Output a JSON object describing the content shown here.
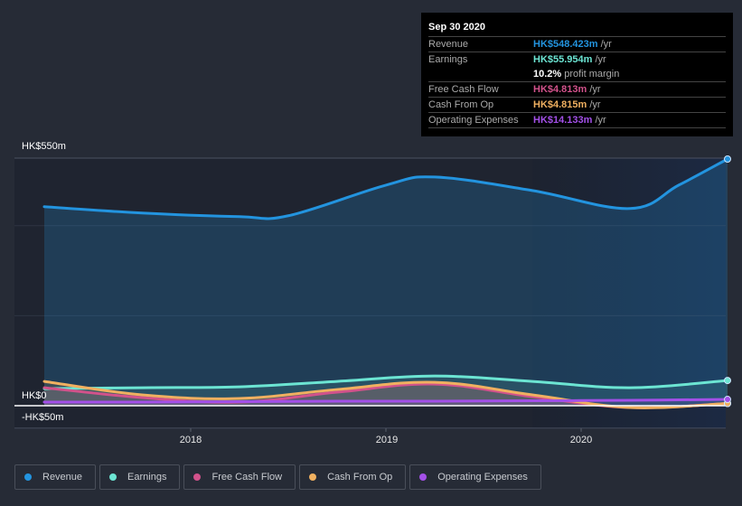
{
  "tooltip": {
    "date": "Sep 30 2020",
    "rows": [
      {
        "label": "Revenue",
        "value": "HK$548.423m",
        "unit": "/yr",
        "color": "#2394df"
      },
      {
        "label": "Earnings",
        "value": "HK$55.954m",
        "unit": "/yr",
        "color": "#6ce5d3"
      },
      {
        "label": "",
        "value": "10.2%",
        "unit": "profit margin",
        "color": "#ffffff"
      },
      {
        "label": "Free Cash Flow",
        "value": "HK$4.813m",
        "unit": "/yr",
        "color": "#d2528b"
      },
      {
        "label": "Cash From Op",
        "value": "HK$4.815m",
        "unit": "/yr",
        "color": "#f0b060"
      },
      {
        "label": "Operating Expenses",
        "value": "HK$14.133m",
        "unit": "/yr",
        "color": "#a350e8"
      }
    ]
  },
  "legend": [
    {
      "label": "Revenue",
      "color": "#2394df"
    },
    {
      "label": "Earnings",
      "color": "#6ce5d3"
    },
    {
      "label": "Free Cash Flow",
      "color": "#d2528b"
    },
    {
      "label": "Cash From Op",
      "color": "#f0b060"
    },
    {
      "label": "Operating Expenses",
      "color": "#a350e8"
    }
  ],
  "chart_data": {
    "type": "area",
    "title": "",
    "xlabel": "",
    "ylabel": "",
    "ylim": [
      -50,
      550
    ],
    "y_tick_labels": [
      "HK$550m",
      "HK$0",
      "-HK$50m"
    ],
    "y_ticks": [
      550,
      0,
      -50
    ],
    "x_tick_labels": [
      "2018",
      "2019",
      "2020"
    ],
    "x_ticks": [
      2018,
      2019,
      2020
    ],
    "xlim": [
      2017.25,
      2020.75
    ],
    "highlight_from": 2019.75,
    "legend_position": "bottom-left",
    "series": [
      {
        "name": "Revenue",
        "color": "#2394df",
        "x": [
          2017.25,
          2017.75,
          2018.25,
          2018.5,
          2019.0,
          2019.25,
          2019.75,
          2020.25,
          2020.5,
          2020.75
        ],
        "values": [
          442,
          428,
          420,
          422,
          490,
          508,
          478,
          438,
          490,
          548
        ]
      },
      {
        "name": "Earnings",
        "color": "#6ce5d3",
        "x": [
          2017.25,
          2017.75,
          2018.25,
          2018.75,
          2019.25,
          2019.75,
          2020.25,
          2020.75
        ],
        "values": [
          38,
          40,
          42,
          54,
          66,
          54,
          40,
          56
        ]
      },
      {
        "name": "Free Cash Flow",
        "color": "#d2528b",
        "x": [
          2017.25,
          2017.75,
          2018.25,
          2018.75,
          2019.25,
          2019.75,
          2020.25,
          2020.75
        ],
        "values": [
          40,
          18,
          8,
          30,
          48,
          20,
          -4,
          5
        ]
      },
      {
        "name": "Cash From Op",
        "color": "#f0b060",
        "x": [
          2017.25,
          2017.75,
          2018.25,
          2018.75,
          2019.25,
          2019.75,
          2020.25,
          2020.75
        ],
        "values": [
          54,
          24,
          16,
          36,
          52,
          24,
          -4,
          5
        ]
      },
      {
        "name": "Operating Expenses",
        "color": "#a350e8",
        "x": [
          2017.25,
          2017.75,
          2018.25,
          2018.75,
          2019.25,
          2019.75,
          2020.25,
          2020.75
        ],
        "values": [
          8,
          8,
          9,
          10,
          10,
          11,
          12,
          14
        ]
      }
    ]
  }
}
